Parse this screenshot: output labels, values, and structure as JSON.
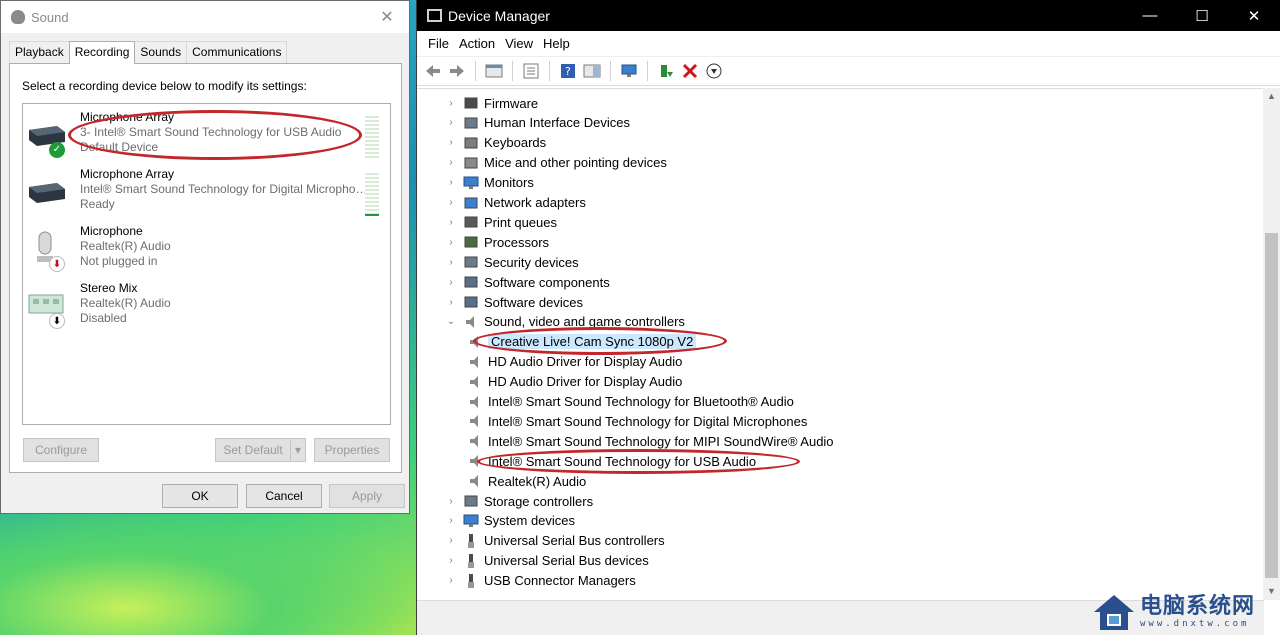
{
  "sound_dialog": {
    "title": "Sound",
    "tabs": [
      {
        "label": "Playback"
      },
      {
        "label": "Recording"
      },
      {
        "label": "Sounds"
      },
      {
        "label": "Communications"
      }
    ],
    "active_tab": "Recording",
    "instruction": "Select a recording device below to modify its settings:",
    "devices": [
      {
        "name": "Microphone Array",
        "driver": "3- Intel® Smart Sound Technology for USB Audio",
        "status": "Default Device",
        "icon": "headset-mic-icon",
        "badge": "check",
        "level": 0.0
      },
      {
        "name": "Microphone Array",
        "driver": "Intel® Smart Sound Technology for Digital Microphon...",
        "status": "Ready",
        "icon": "headset-mic-icon",
        "badge": "",
        "level": 0.05
      },
      {
        "name": "Microphone",
        "driver": "Realtek(R) Audio",
        "status": "Not plugged in",
        "icon": "microphone-icon",
        "badge": "down-arrow-red",
        "level": null
      },
      {
        "name": "Stereo Mix",
        "driver": "Realtek(R) Audio",
        "status": "Disabled",
        "icon": "sound-card-icon",
        "badge": "down-arrow-black",
        "level": null
      }
    ],
    "buttons": {
      "configure": "Configure",
      "set_default": "Set Default",
      "properties": "Properties",
      "ok": "OK",
      "cancel": "Cancel",
      "apply": "Apply"
    }
  },
  "device_manager": {
    "title": "Device Manager",
    "window_controls": {
      "minimize": "—",
      "maximize": "☐",
      "close": "✕"
    },
    "menu": [
      "File",
      "Action",
      "View",
      "Help"
    ],
    "tree": [
      {
        "label": "Firmware",
        "icon": "firmware-icon",
        "level": 0,
        "expander": "›"
      },
      {
        "label": "Human Interface Devices",
        "icon": "hid-icon",
        "level": 0,
        "expander": "›"
      },
      {
        "label": "Keyboards",
        "icon": "keyboard-icon",
        "level": 0,
        "expander": "›"
      },
      {
        "label": "Mice and other pointing devices",
        "icon": "mouse-icon",
        "level": 0,
        "expander": "›"
      },
      {
        "label": "Monitors",
        "icon": "monitor-icon",
        "level": 0,
        "expander": "›"
      },
      {
        "label": "Network adapters",
        "icon": "network-icon",
        "level": 0,
        "expander": "›"
      },
      {
        "label": "Print queues",
        "icon": "printer-icon",
        "level": 0,
        "expander": "›"
      },
      {
        "label": "Processors",
        "icon": "processor-icon",
        "level": 0,
        "expander": "›"
      },
      {
        "label": "Security devices",
        "icon": "security-icon",
        "level": 0,
        "expander": "›"
      },
      {
        "label": "Software components",
        "icon": "software-component-icon",
        "level": 0,
        "expander": "›"
      },
      {
        "label": "Software devices",
        "icon": "software-device-icon",
        "level": 0,
        "expander": "›"
      },
      {
        "label": "Sound, video and game controllers",
        "icon": "speaker-icon",
        "level": 0,
        "expander": "⌄"
      },
      {
        "label": "Creative Live! Cam Sync 1080p V2",
        "icon": "speaker-icon",
        "level": 1,
        "expander": "",
        "selected": true
      },
      {
        "label": "HD Audio Driver for Display Audio",
        "icon": "speaker-icon",
        "level": 1,
        "expander": ""
      },
      {
        "label": "HD Audio Driver for Display Audio",
        "icon": "speaker-icon",
        "level": 1,
        "expander": ""
      },
      {
        "label": "Intel® Smart Sound Technology for Bluetooth® Audio",
        "icon": "speaker-icon",
        "level": 1,
        "expander": ""
      },
      {
        "label": "Intel® Smart Sound Technology for Digital Microphones",
        "icon": "speaker-icon",
        "level": 1,
        "expander": ""
      },
      {
        "label": "Intel® Smart Sound Technology for MIPI SoundWire® Audio",
        "icon": "speaker-icon",
        "level": 1,
        "expander": ""
      },
      {
        "label": "Intel® Smart Sound Technology for USB Audio",
        "icon": "speaker-icon",
        "level": 1,
        "expander": ""
      },
      {
        "label": "Realtek(R) Audio",
        "icon": "speaker-icon",
        "level": 1,
        "expander": ""
      },
      {
        "label": "Storage controllers",
        "icon": "storage-icon",
        "level": 0,
        "expander": "›"
      },
      {
        "label": "System devices",
        "icon": "system-icon",
        "level": 0,
        "expander": "›"
      },
      {
        "label": "Universal Serial Bus controllers",
        "icon": "usb-icon",
        "level": 0,
        "expander": "›"
      },
      {
        "label": "Universal Serial Bus devices",
        "icon": "usb-icon",
        "level": 0,
        "expander": "›"
      },
      {
        "label": "USB Connector Managers",
        "icon": "usb-icon",
        "level": 0,
        "expander": "›"
      }
    ]
  },
  "watermark": {
    "text": "电脑系统网",
    "url": "www.dnxtw.com"
  }
}
